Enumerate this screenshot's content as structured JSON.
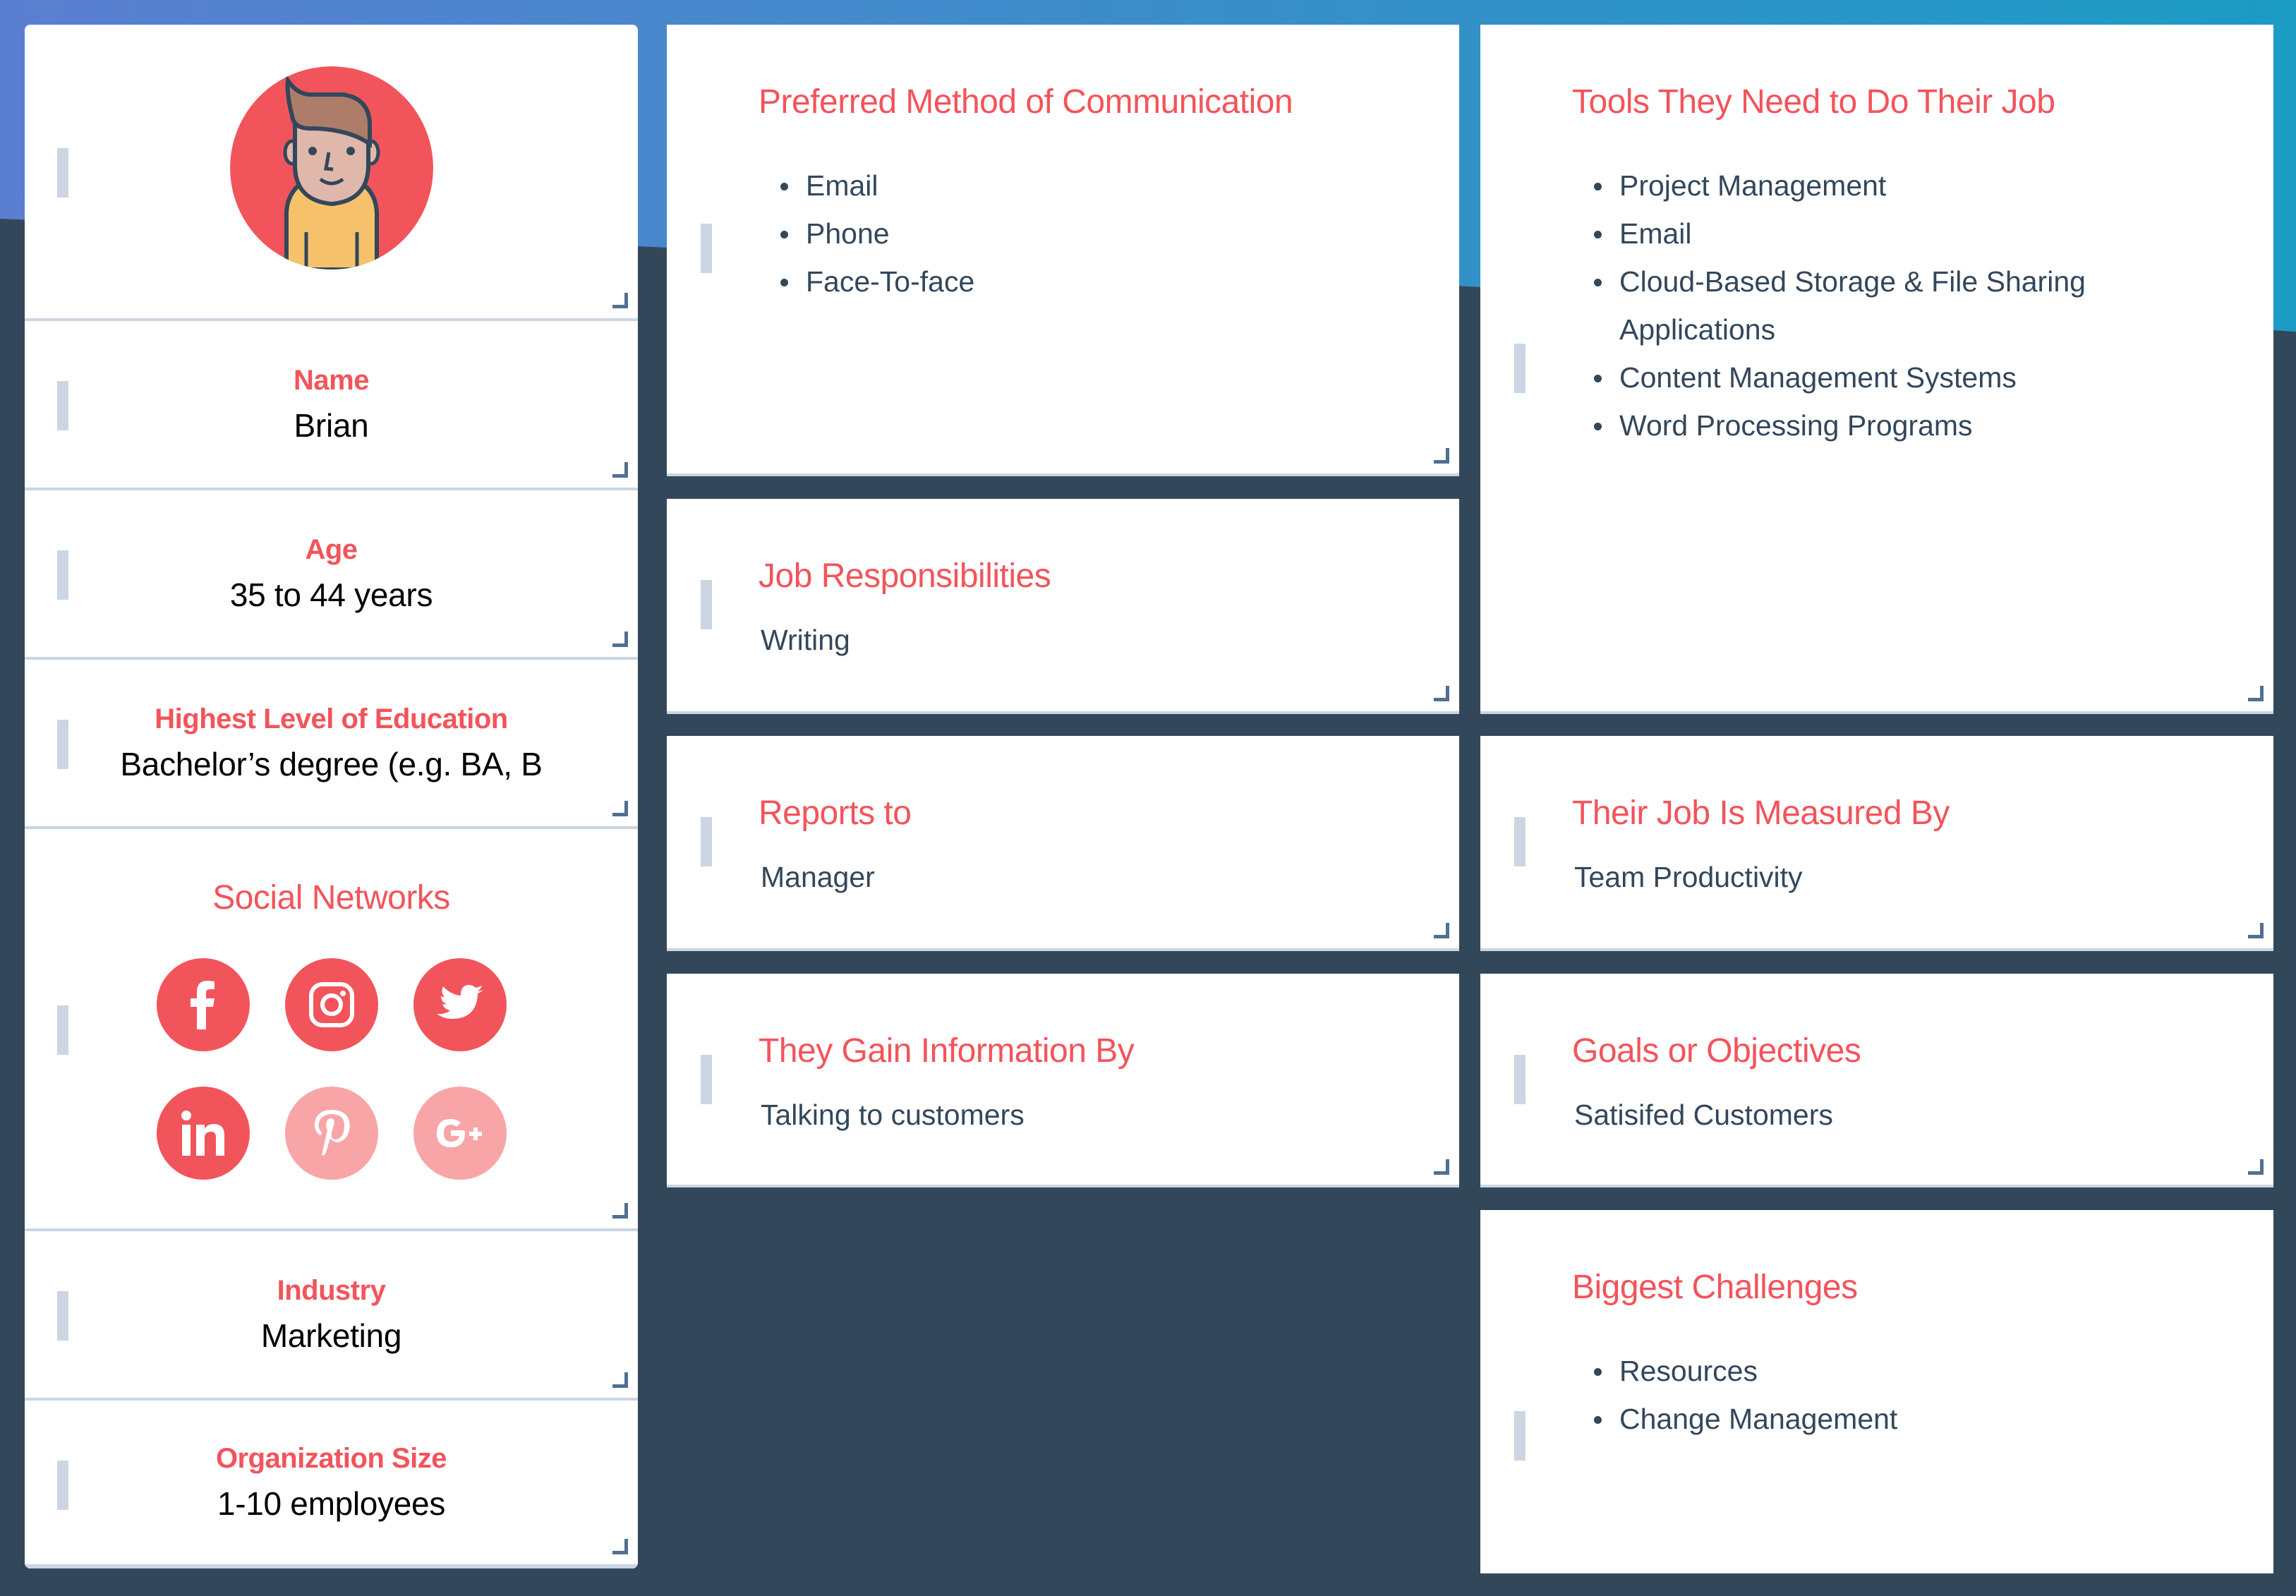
{
  "colors": {
    "accent": "#f2545b",
    "accent_inactive": "#f8a5a8",
    "text_dark": "#33475b",
    "background_dark": "#33475b",
    "gradient_start": "#5b7fd0",
    "gradient_end": "#1c9bc4",
    "divider": "#cbd6e2"
  },
  "profile": {
    "avatar_icon": "persona-avatar-icon",
    "name": {
      "label": "Name",
      "value": "Brian"
    },
    "age": {
      "label": "Age",
      "value": "35 to 44 years"
    },
    "education": {
      "label": "Highest Level of Education",
      "value": "Bachelor’s degree (e.g. BA, B"
    },
    "social": {
      "label": "Social Networks",
      "networks": [
        {
          "name": "Facebook",
          "icon": "facebook-icon",
          "active": true
        },
        {
          "name": "Instagram",
          "icon": "instagram-icon",
          "active": true
        },
        {
          "name": "Twitter",
          "icon": "twitter-icon",
          "active": true
        },
        {
          "name": "LinkedIn",
          "icon": "linkedin-icon",
          "active": true
        },
        {
          "name": "Pinterest",
          "icon": "pinterest-icon",
          "active": false
        },
        {
          "name": "Google+",
          "icon": "google-plus-icon",
          "active": false
        }
      ]
    },
    "industry": {
      "label": "Industry",
      "value": "Marketing"
    },
    "org_size": {
      "label": "Organization Size",
      "value": "1-10 employees"
    }
  },
  "cards": {
    "communication": {
      "title": "Preferred Method of Communication",
      "items": [
        "Email",
        "Phone",
        "Face-To-face"
      ]
    },
    "tools": {
      "title": "Tools They Need to Do Their Job",
      "items": [
        "Project Management",
        "Email",
        "Cloud-Based Storage & File Sharing Applications",
        "Content Management Systems",
        "Word Processing Programs"
      ]
    },
    "responsibilities": {
      "title": "Job Responsibilities",
      "value": "Writing"
    },
    "measured_by": {
      "title": "Their Job Is Measured By",
      "value": "Team Productivity"
    },
    "reports_to": {
      "title": "Reports to",
      "value": "Manager"
    },
    "goals": {
      "title": "Goals or Objectives",
      "value": "Satisifed Customers"
    },
    "info_source": {
      "title": "They Gain Information By",
      "value": "Talking to customers"
    },
    "challenges": {
      "title": "Biggest Challenges",
      "items": [
        "Resources",
        "Change Management"
      ]
    }
  }
}
